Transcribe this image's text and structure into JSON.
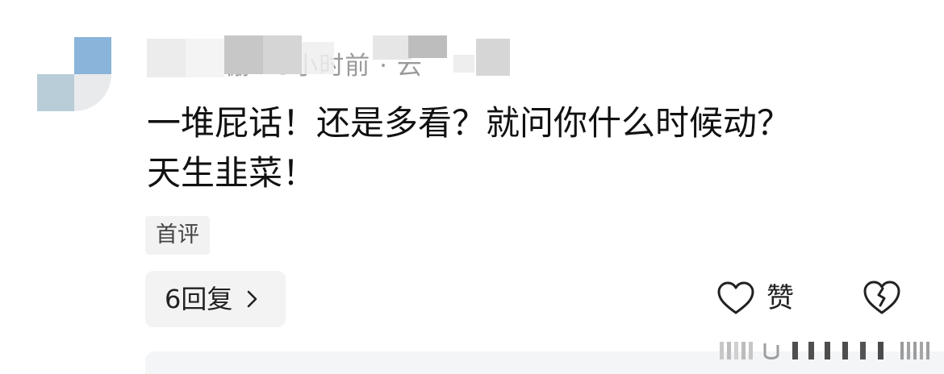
{
  "comment": {
    "username_obscured": "",
    "meta_visible": "仁发小棚 · 5小时前 · 云",
    "body_line1": "一堆屁话！还是多看？就问你什么时候动？",
    "body_line2": "天生韭菜！",
    "tag": "首评"
  },
  "actions": {
    "replies_label": "6回复",
    "like_label": "赞"
  },
  "icons": {
    "chevron": "chevron-right-icon",
    "like": "heart-outline-icon",
    "dislike": "broken-heart-icon"
  },
  "colors": {
    "text": "#111111",
    "meta": "#9a9a9a",
    "tag_bg": "#f2f2f2",
    "button_bg": "#f3f3f3"
  }
}
